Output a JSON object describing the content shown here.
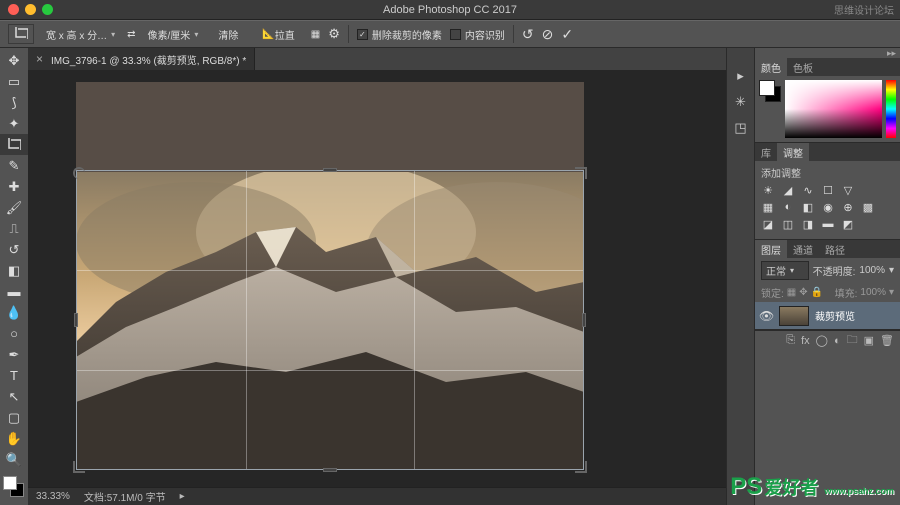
{
  "titlebar": {
    "app_title": "Adobe Photoshop CC 2017",
    "forum": "思维设计论坛"
  },
  "options": {
    "crop_tool": "crop",
    "ratio_preset": "宽 x 高 x 分…",
    "resolution_unit": "像素/厘米",
    "clear_btn": "清除",
    "straighten": "拉直",
    "overlay": "grid",
    "gear": "gear",
    "delete_cropped": "删除裁剪的像素",
    "content_aware": "内容识别",
    "reset": "↺",
    "cancel": "⊘",
    "commit": "✓"
  },
  "tab": {
    "label": "IMG_3796-1 @ 33.3% (裁剪预览, RGB/8*) *",
    "close": "×"
  },
  "status": {
    "zoom": "33.33%",
    "docsize": "文档:57.1M/0 字节"
  },
  "tools": {
    "move": "move",
    "marquee": "marquee",
    "lasso": "lasso",
    "wand": "wand",
    "crop": "crop",
    "eyedrop": "eyedrop",
    "heal": "heal",
    "brush": "brush",
    "stamp": "stamp",
    "history": "history",
    "eraser": "eraser",
    "gradient": "gradient",
    "blur": "blur",
    "dodge": "dodge",
    "pen": "pen",
    "type": "type",
    "path": "path",
    "shape": "shape",
    "hand": "hand",
    "zoom": "zoom"
  },
  "right": {
    "color_tab": "颜色",
    "swatch_tab": "色板",
    "lib_tab": "库",
    "adjust_tab": "调整",
    "add_adjust": "添加调整",
    "layers_tab": "图层",
    "channels_tab": "通道",
    "paths_tab": "路径",
    "blendmode": "正常",
    "opacity_label": "不透明度:",
    "opacity_val": "100%",
    "lock_label": "锁定:",
    "fill_label": "填充:",
    "fill_val": "100%",
    "layer": {
      "name": "裁剪预览"
    }
  },
  "watermark": {
    "text": "爱好者",
    "prefix": "PS",
    "url": "www.psahz.com"
  }
}
